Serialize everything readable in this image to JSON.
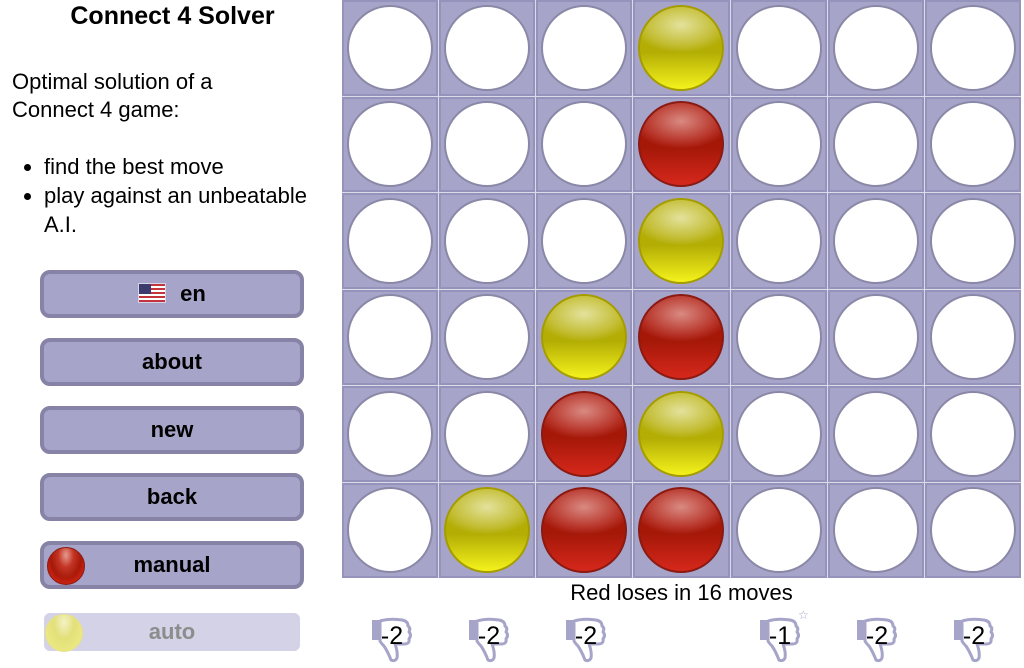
{
  "sidebar": {
    "title": "Connect 4 Solver",
    "intro_line1": "Optimal solution of a",
    "intro_line2": "Connect 4 game:",
    "features": [
      "find the best move",
      "play against an unbeatable A.I."
    ],
    "buttons": {
      "language": {
        "label": "en",
        "icon": "us-flag-icon"
      },
      "about": {
        "label": "about"
      },
      "new": {
        "label": "new"
      },
      "back": {
        "label": "back"
      },
      "manual": {
        "label": "manual",
        "icon": "red-piece-icon",
        "active": true
      },
      "auto": {
        "label": "auto",
        "icon": "yellow-piece-icon",
        "active": false
      }
    }
  },
  "board": {
    "rows": 6,
    "columns": 7,
    "grid": [
      [
        "empty",
        "empty",
        "empty",
        "yellow",
        "empty",
        "empty",
        "empty"
      ],
      [
        "empty",
        "empty",
        "empty",
        "red",
        "empty",
        "empty",
        "empty"
      ],
      [
        "empty",
        "empty",
        "empty",
        "yellow",
        "empty",
        "empty",
        "empty"
      ],
      [
        "empty",
        "empty",
        "yellow",
        "red",
        "empty",
        "empty",
        "empty"
      ],
      [
        "empty",
        "empty",
        "red",
        "yellow",
        "empty",
        "empty",
        "empty"
      ],
      [
        "empty",
        "yellow",
        "red",
        "red",
        "empty",
        "empty",
        "empty"
      ]
    ]
  },
  "status": "Red loses in 16 moves",
  "hints": [
    {
      "column": 0,
      "score": "-2",
      "icon": "thumbs-down-icon",
      "best": false
    },
    {
      "column": 1,
      "score": "-2",
      "icon": "thumbs-down-icon",
      "best": false
    },
    {
      "column": 2,
      "score": "-2",
      "icon": "thumbs-down-icon",
      "best": false
    },
    {
      "column": 3,
      "score": null
    },
    {
      "column": 4,
      "score": "-1",
      "icon": "thumbs-down-icon",
      "best": true
    },
    {
      "column": 5,
      "score": "-2",
      "icon": "thumbs-down-icon",
      "best": false
    },
    {
      "column": 6,
      "score": "-2",
      "icon": "thumbs-down-icon",
      "best": false
    }
  ],
  "colors": {
    "board": "#a6a4c9",
    "button_border": "#8683a6",
    "red": "#a51808",
    "yellow": "#b3ad04"
  }
}
